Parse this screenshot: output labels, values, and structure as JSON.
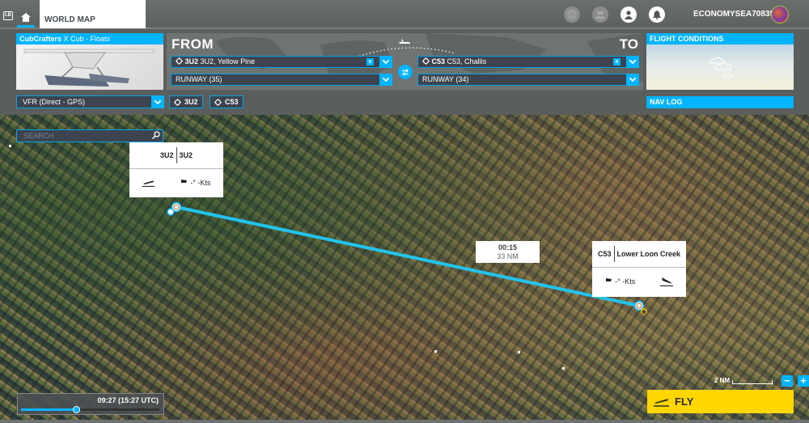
{
  "topbar": {
    "lb_label": "LB",
    "active_tab": "WORLD MAP",
    "icons": [
      "activity-icon",
      "friends-icon",
      "profile-icon",
      "notifications-icon"
    ],
    "username": "ECONOMYSEA70835"
  },
  "aircraft": {
    "brand": "CubCrafters",
    "model": " X Cub - Floats"
  },
  "route": {
    "from_label": "FROM",
    "to_label": "TO",
    "departure": {
      "code": "3U2",
      "name": "3U2, Yellow Pine",
      "runway": "RUNWAY (35)"
    },
    "arrival": {
      "code": "C53",
      "name": "C53, Challis",
      "runway": "RUNWAY (34)"
    },
    "clear_label": "x"
  },
  "flight_conditions": {
    "title": "FLIGHT CONDITIONS"
  },
  "flight_rules": {
    "selected": "VFR (Direct - GPS)"
  },
  "waypoint_buttons": [
    "3U2",
    "C53"
  ],
  "nav_log": {
    "label": "NAV LOG"
  },
  "map": {
    "search_placeholder": "SEARCH",
    "departure_popup": {
      "code": "3U2",
      "name": "3U2",
      "wind": "-° -Kts"
    },
    "arrival_popup": {
      "code": "C53",
      "name": "Lower Loon Creek",
      "wind": "-° -Kts"
    },
    "leg": {
      "time": "00:15",
      "distance": "33 NM"
    },
    "time_of_day": {
      "label": "09:27 (15:27 UTC)",
      "slider_fraction": 0.4
    },
    "scale_label": "2 NM",
    "zoom_out": "−",
    "zoom_in": "+",
    "route_color": "#22c4ee"
  },
  "fly_button": {
    "label": "FLY",
    "color": "#ffd600"
  },
  "accent_color": "#00b4ff"
}
